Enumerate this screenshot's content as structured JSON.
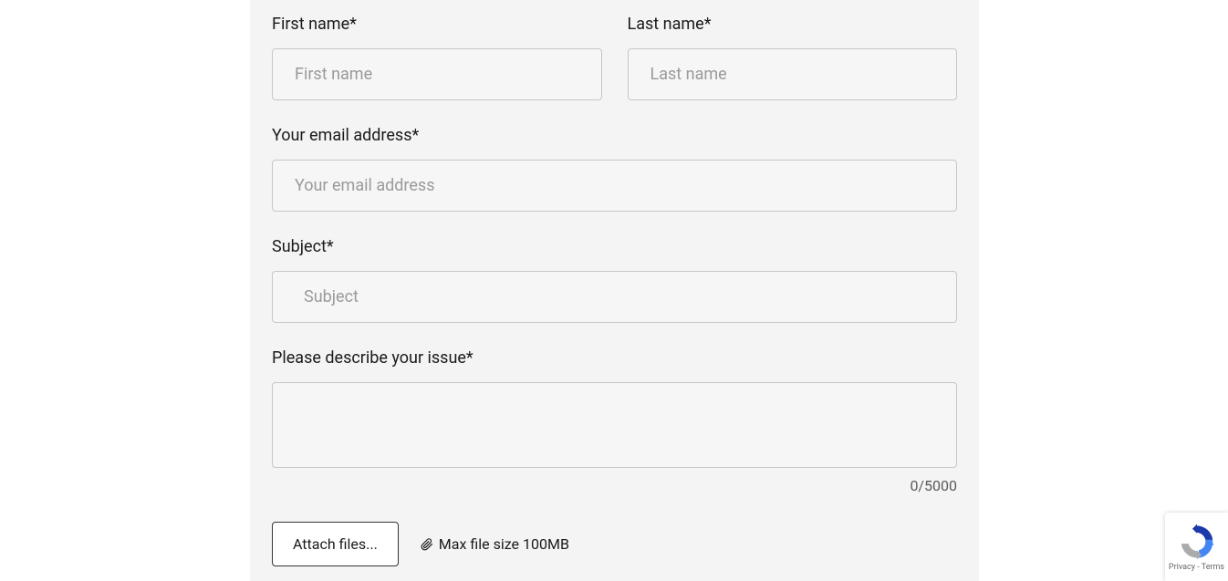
{
  "form": {
    "firstName": {
      "label": "First name*",
      "placeholder": "First name",
      "value": ""
    },
    "lastName": {
      "label": "Last name*",
      "placeholder": "Last name",
      "value": ""
    },
    "email": {
      "label": "Your email address*",
      "placeholder": "Your email address",
      "value": ""
    },
    "subject": {
      "label": "Subject*",
      "placeholder": "Subject",
      "value": ""
    },
    "description": {
      "label": "Please describe your issue*",
      "value": ""
    },
    "charCounter": "0/5000",
    "attachButton": "Attach files...",
    "fileSizeNote": "Max file size 100MB"
  },
  "recaptcha": {
    "links": "Privacy - Terms"
  }
}
